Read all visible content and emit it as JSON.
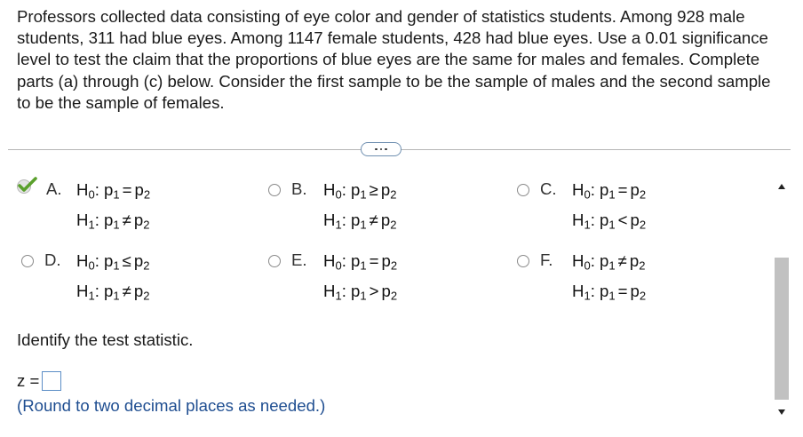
{
  "problem": {
    "text": "Professors collected data consisting of eye color and gender of statistics students. Among 928 male students, 311 had blue eyes. Among 1147 female students, 428 had blue eyes. Use a 0.01 significance level to test the claim that the proportions of blue eyes are the same for males and females. Complete parts (a) through (c) below. Consider the first sample to be the sample of males and the second sample to be the sample of females."
  },
  "options": [
    {
      "letter": "A.",
      "selected": true,
      "h0": {
        "label": "H",
        "sub": "0",
        "lhs": "p",
        "lhs_sub": "1",
        "rel": "=",
        "rhs": "p",
        "rhs_sub": "2"
      },
      "h1": {
        "label": "H",
        "sub": "1",
        "lhs": "p",
        "lhs_sub": "1",
        "rel": "≠",
        "rhs": "p",
        "rhs_sub": "2"
      }
    },
    {
      "letter": "B.",
      "selected": false,
      "h0": {
        "label": "H",
        "sub": "0",
        "lhs": "p",
        "lhs_sub": "1",
        "rel": "≥",
        "rhs": "p",
        "rhs_sub": "2"
      },
      "h1": {
        "label": "H",
        "sub": "1",
        "lhs": "p",
        "lhs_sub": "1",
        "rel": "≠",
        "rhs": "p",
        "rhs_sub": "2"
      }
    },
    {
      "letter": "C.",
      "selected": false,
      "h0": {
        "label": "H",
        "sub": "0",
        "lhs": "p",
        "lhs_sub": "1",
        "rel": "=",
        "rhs": "p",
        "rhs_sub": "2"
      },
      "h1": {
        "label": "H",
        "sub": "1",
        "lhs": "p",
        "lhs_sub": "1",
        "rel": "<",
        "rhs": "p",
        "rhs_sub": "2"
      }
    },
    {
      "letter": "D.",
      "selected": false,
      "h0": {
        "label": "H",
        "sub": "0",
        "lhs": "p",
        "lhs_sub": "1",
        "rel": "≤",
        "rhs": "p",
        "rhs_sub": "2"
      },
      "h1": {
        "label": "H",
        "sub": "1",
        "lhs": "p",
        "lhs_sub": "1",
        "rel": "≠",
        "rhs": "p",
        "rhs_sub": "2"
      }
    },
    {
      "letter": "E.",
      "selected": false,
      "h0": {
        "label": "H",
        "sub": "0",
        "lhs": "p",
        "lhs_sub": "1",
        "rel": "=",
        "rhs": "p",
        "rhs_sub": "2"
      },
      "h1": {
        "label": "H",
        "sub": "1",
        "lhs": "p",
        "lhs_sub": "1",
        "rel": ">",
        "rhs": "p",
        "rhs_sub": "2"
      }
    },
    {
      "letter": "F.",
      "selected": false,
      "h0": {
        "label": "H",
        "sub": "0",
        "lhs": "p",
        "lhs_sub": "1",
        "rel": "≠",
        "rhs": "p",
        "rhs_sub": "2"
      },
      "h1": {
        "label": "H",
        "sub": "1",
        "lhs": "p",
        "lhs_sub": "1",
        "rel": "=",
        "rhs": "p",
        "rhs_sub": "2"
      }
    }
  ],
  "prompt": "Identify the test statistic.",
  "answer": {
    "label": "z =",
    "value": ""
  },
  "hint": "(Round to two decimal places as needed.)",
  "colors": {
    "check": "#5aa02c",
    "link": "#1f4e91",
    "input_border": "#5b8dc6"
  },
  "icons": {
    "check": "check-icon",
    "more": "more-dots-icon"
  }
}
